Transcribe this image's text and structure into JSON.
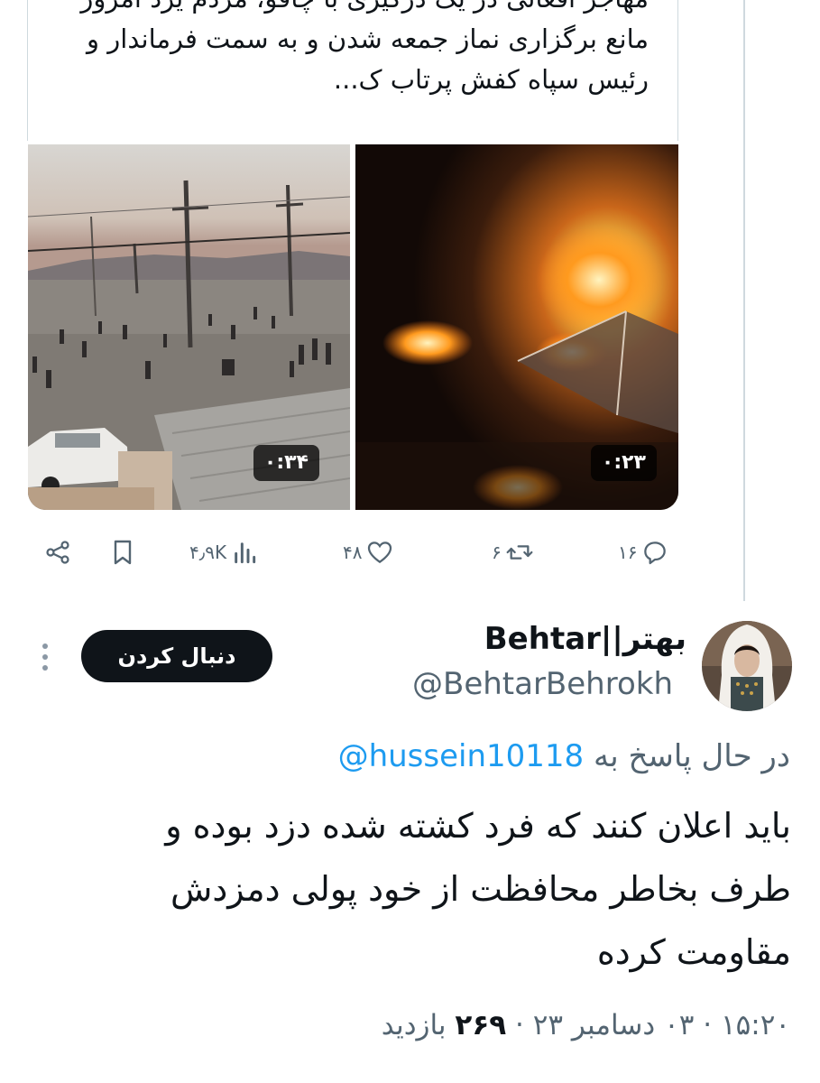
{
  "quoted_tweet": {
    "text": "مهاجر افغانی در یک درگیری با چاقو، مردم یزد امروز مانع برگزاری نماز جمعه شدن و به سمت فرماندار و رئیس سپاه کفش پرتاب ک..."
  },
  "media": [
    {
      "duration": "۰:۳۴"
    },
    {
      "duration": "۰:۲۳"
    }
  ],
  "actions": {
    "replies": "۱۶",
    "retweets": "۶",
    "likes": "۴۸",
    "views": "۴٫۹K"
  },
  "reply_tweet": {
    "display_name": "Behtar||بهتر",
    "handle": "@BehtarBehrokh",
    "follow_label": "دنبال کردن",
    "replying_prefix": "در حال پاسخ به",
    "replying_to": "@hussein10118",
    "text": "باید اعلان کنند که فرد کشته شده دزد بوده و طرف بخاطر محافظت از خود پولی دمزدش مقاومت کرده",
    "time": "۱۵:۲۰",
    "date": "۰۳ دسامبر ۲۳",
    "views_count": "۲۶۹",
    "views_label": "بازدید"
  },
  "colors": {
    "text": "#0f1419",
    "secondary": "#536471",
    "link": "#1d9bf0",
    "border": "#cfd9de"
  },
  "icons": [
    "share-icon",
    "bookmark-icon",
    "views-icon",
    "like-icon",
    "retweet-icon",
    "reply-icon",
    "more-icon"
  ]
}
